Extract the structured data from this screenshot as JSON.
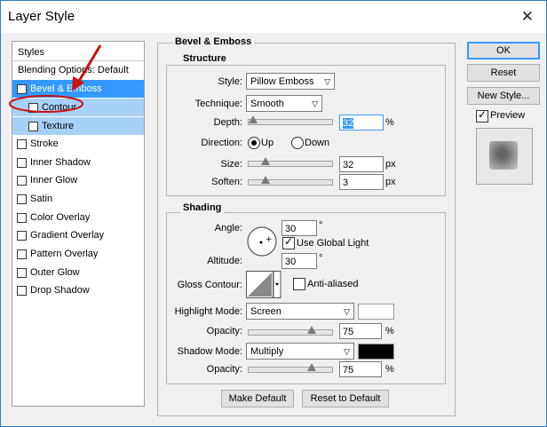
{
  "window": {
    "title": "Layer Style",
    "close_glyph": "✕"
  },
  "styles_list": {
    "header": "Styles",
    "blending": "Blending Options: Default",
    "items": [
      {
        "label": "Bevel & Emboss",
        "checked": true
      },
      {
        "label": "Contour",
        "checked": false
      },
      {
        "label": "Texture",
        "checked": false
      },
      {
        "label": "Stroke",
        "checked": false
      },
      {
        "label": "Inner Shadow",
        "checked": false
      },
      {
        "label": "Inner Glow",
        "checked": false
      },
      {
        "label": "Satin",
        "checked": false
      },
      {
        "label": "Color Overlay",
        "checked": false
      },
      {
        "label": "Gradient Overlay",
        "checked": false
      },
      {
        "label": "Pattern Overlay",
        "checked": false
      },
      {
        "label": "Outer Glow",
        "checked": false
      },
      {
        "label": "Drop Shadow",
        "checked": false
      }
    ]
  },
  "bevel": {
    "section_title": "Bevel & Emboss",
    "structure": {
      "title": "Structure",
      "style_label": "Style:",
      "style_value": "Pillow Emboss",
      "technique_label": "Technique:",
      "technique_value": "Smooth",
      "depth_label": "Depth:",
      "depth_value": "32",
      "depth_unit": "%",
      "direction_label": "Direction:",
      "direction_up": "Up",
      "direction_down": "Down",
      "size_label": "Size:",
      "size_value": "32",
      "size_unit": "px",
      "soften_label": "Soften:",
      "soften_value": "3",
      "soften_unit": "px"
    },
    "shading": {
      "title": "Shading",
      "angle_label": "Angle:",
      "angle_value": "30",
      "angle_unit": "°",
      "use_global_light": "Use Global Light",
      "altitude_label": "Altitude:",
      "altitude_value": "30",
      "altitude_unit": "°",
      "gloss_contour_label": "Gloss Contour:",
      "anti_aliased": "Anti-aliased",
      "highlight_mode_label": "Highlight Mode:",
      "highlight_mode_value": "Screen",
      "highlight_opacity_label": "Opacity:",
      "highlight_opacity_value": "75",
      "highlight_opacity_unit": "%",
      "highlight_color": "#ffffff",
      "shadow_mode_label": "Shadow Mode:",
      "shadow_mode_value": "Multiply",
      "shadow_opacity_label": "Opacity:",
      "shadow_opacity_value": "75",
      "shadow_opacity_unit": "%",
      "shadow_color": "#000000"
    },
    "make_default": "Make Default",
    "reset_default": "Reset to Default"
  },
  "buttons": {
    "ok": "OK",
    "reset": "Reset",
    "new_style": "New Style...",
    "preview": "Preview"
  },
  "accent_color": "#3399ff",
  "annotation_color": "#cc1111"
}
